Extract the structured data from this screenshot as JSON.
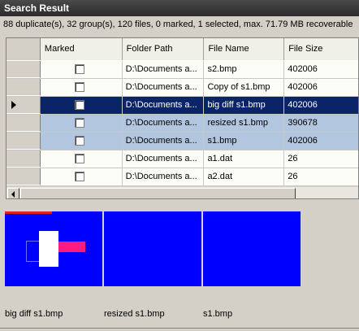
{
  "panel": {
    "title": "Search Result"
  },
  "summary": "88 duplicate(s), 32 group(s), 120 files, 0 marked, 1 selected, max. 71.79 MB recoverable",
  "columns": {
    "marked": "Marked",
    "folder": "Folder Path",
    "file": "File Name",
    "size": "File Size"
  },
  "rows": [
    {
      "folder": "D:\\Documents a...",
      "file": "s2.bmp",
      "size": "402006",
      "marked": false,
      "style": "white"
    },
    {
      "folder": "D:\\Documents a...",
      "file": "Copy of s1.bmp",
      "size": "402006",
      "marked": false,
      "style": "white"
    },
    {
      "folder": "D:\\Documents a...",
      "file": "big diff s1.bmp",
      "size": "402006",
      "marked": false,
      "style": "selected"
    },
    {
      "folder": "D:\\Documents a...",
      "file": "resized s1.bmp",
      "size": "390678",
      "marked": false,
      "style": "group"
    },
    {
      "folder": "D:\\Documents a...",
      "file": "s1.bmp",
      "size": "402006",
      "marked": false,
      "style": "group"
    },
    {
      "folder": "D:\\Documents a...",
      "file": "a1.dat",
      "size": "26",
      "marked": false,
      "style": "white"
    },
    {
      "folder": "D:\\Documents a...",
      "file": "a2.dat",
      "size": "26",
      "marked": false,
      "style": "white"
    }
  ],
  "previews": [
    {
      "caption": "big diff s1.bmp"
    },
    {
      "caption": "resized s1.bmp"
    },
    {
      "caption": "s1.bmp"
    }
  ],
  "colors": {
    "selected_row": "#0b2467",
    "group_row": "#b3c6e0",
    "preview_bg": "#0000ff",
    "pink_block": "#ff1a80"
  }
}
